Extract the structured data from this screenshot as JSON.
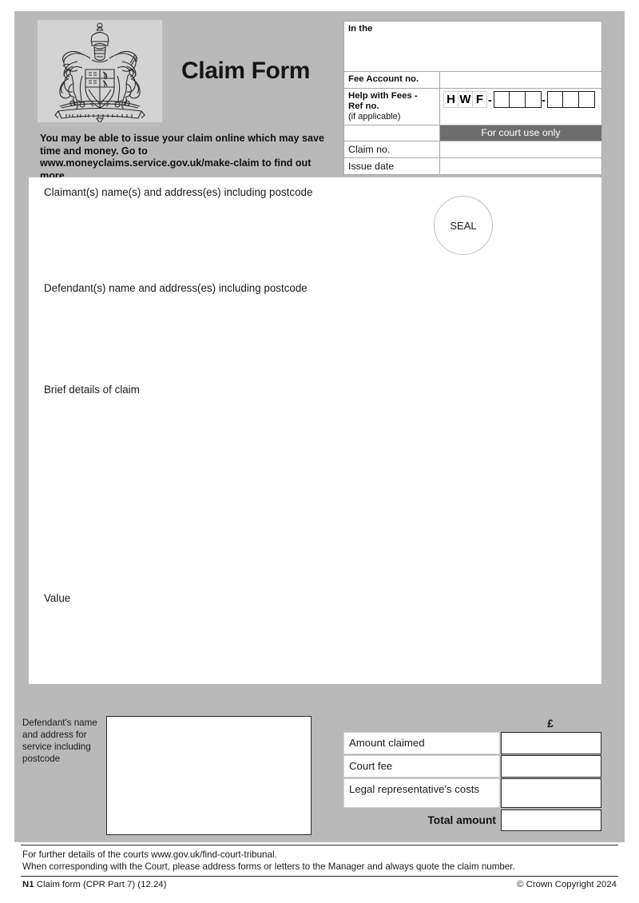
{
  "document": {
    "title": "Claim Form",
    "crest_alt": "royal-coat-of-arms"
  },
  "online_notice": "You may be able to issue your claim online which may save time and money. Go to www.moneyclaims.service.gov.uk/make-claim to find out more.",
  "header_table": {
    "in_the_label": "In the",
    "in_the_value": "",
    "fee_account_label": "Fee Account no.",
    "fee_account_value": "",
    "hwf_label": "Help with Fees -",
    "hwf_label2": "Ref no.",
    "hwf_sub": "(if applicable)",
    "hwf_prefix": [
      "H",
      "W",
      "F"
    ],
    "hwf_separator": "-",
    "hwf_group1": [
      "",
      "",
      ""
    ],
    "hwf_group2": [
      "",
      "",
      ""
    ],
    "court_use_only": "For court use only",
    "claim_no_label": "Claim no.",
    "claim_no_value": "",
    "issue_date_label": "Issue date",
    "issue_date_value": ""
  },
  "main_panel": {
    "claimant_label": "Claimant(s) name(s) and address(es) including postcode",
    "claimant_value": "",
    "defendant_label": "Defendant(s) name and address(es) including postcode",
    "defendant_value": "",
    "brief_details_label": "Brief details of claim",
    "brief_details_value": "",
    "value_label": "Value",
    "value_value": "",
    "seal_label": "SEAL"
  },
  "service_block": {
    "label": "Defendant's name and address for service including postcode",
    "value": ""
  },
  "amounts": {
    "currency_symbol": "£",
    "rows": [
      {
        "label": "Amount claimed",
        "value": ""
      },
      {
        "label": "Court fee",
        "value": ""
      },
      {
        "label": "Legal representative's costs",
        "value": ""
      }
    ],
    "total_label": "Total amount",
    "total_value": ""
  },
  "footer": {
    "line1": "For further details of the courts www.gov.uk/find-court-tribunal.",
    "line2": "When corresponding with the Court, please address forms or letters to the Manager and always quote the claim number.",
    "form_code": "N1",
    "form_desc": "Claim form (CPR Part 7) (12.24)",
    "copyright": "© Crown Copyright 2024"
  },
  "colors": {
    "sheet_grey": "#b9b9b9",
    "crest_grey": "#d3d3d3",
    "court_band": "#6e6e6e",
    "ink": "#1a1a1a"
  }
}
